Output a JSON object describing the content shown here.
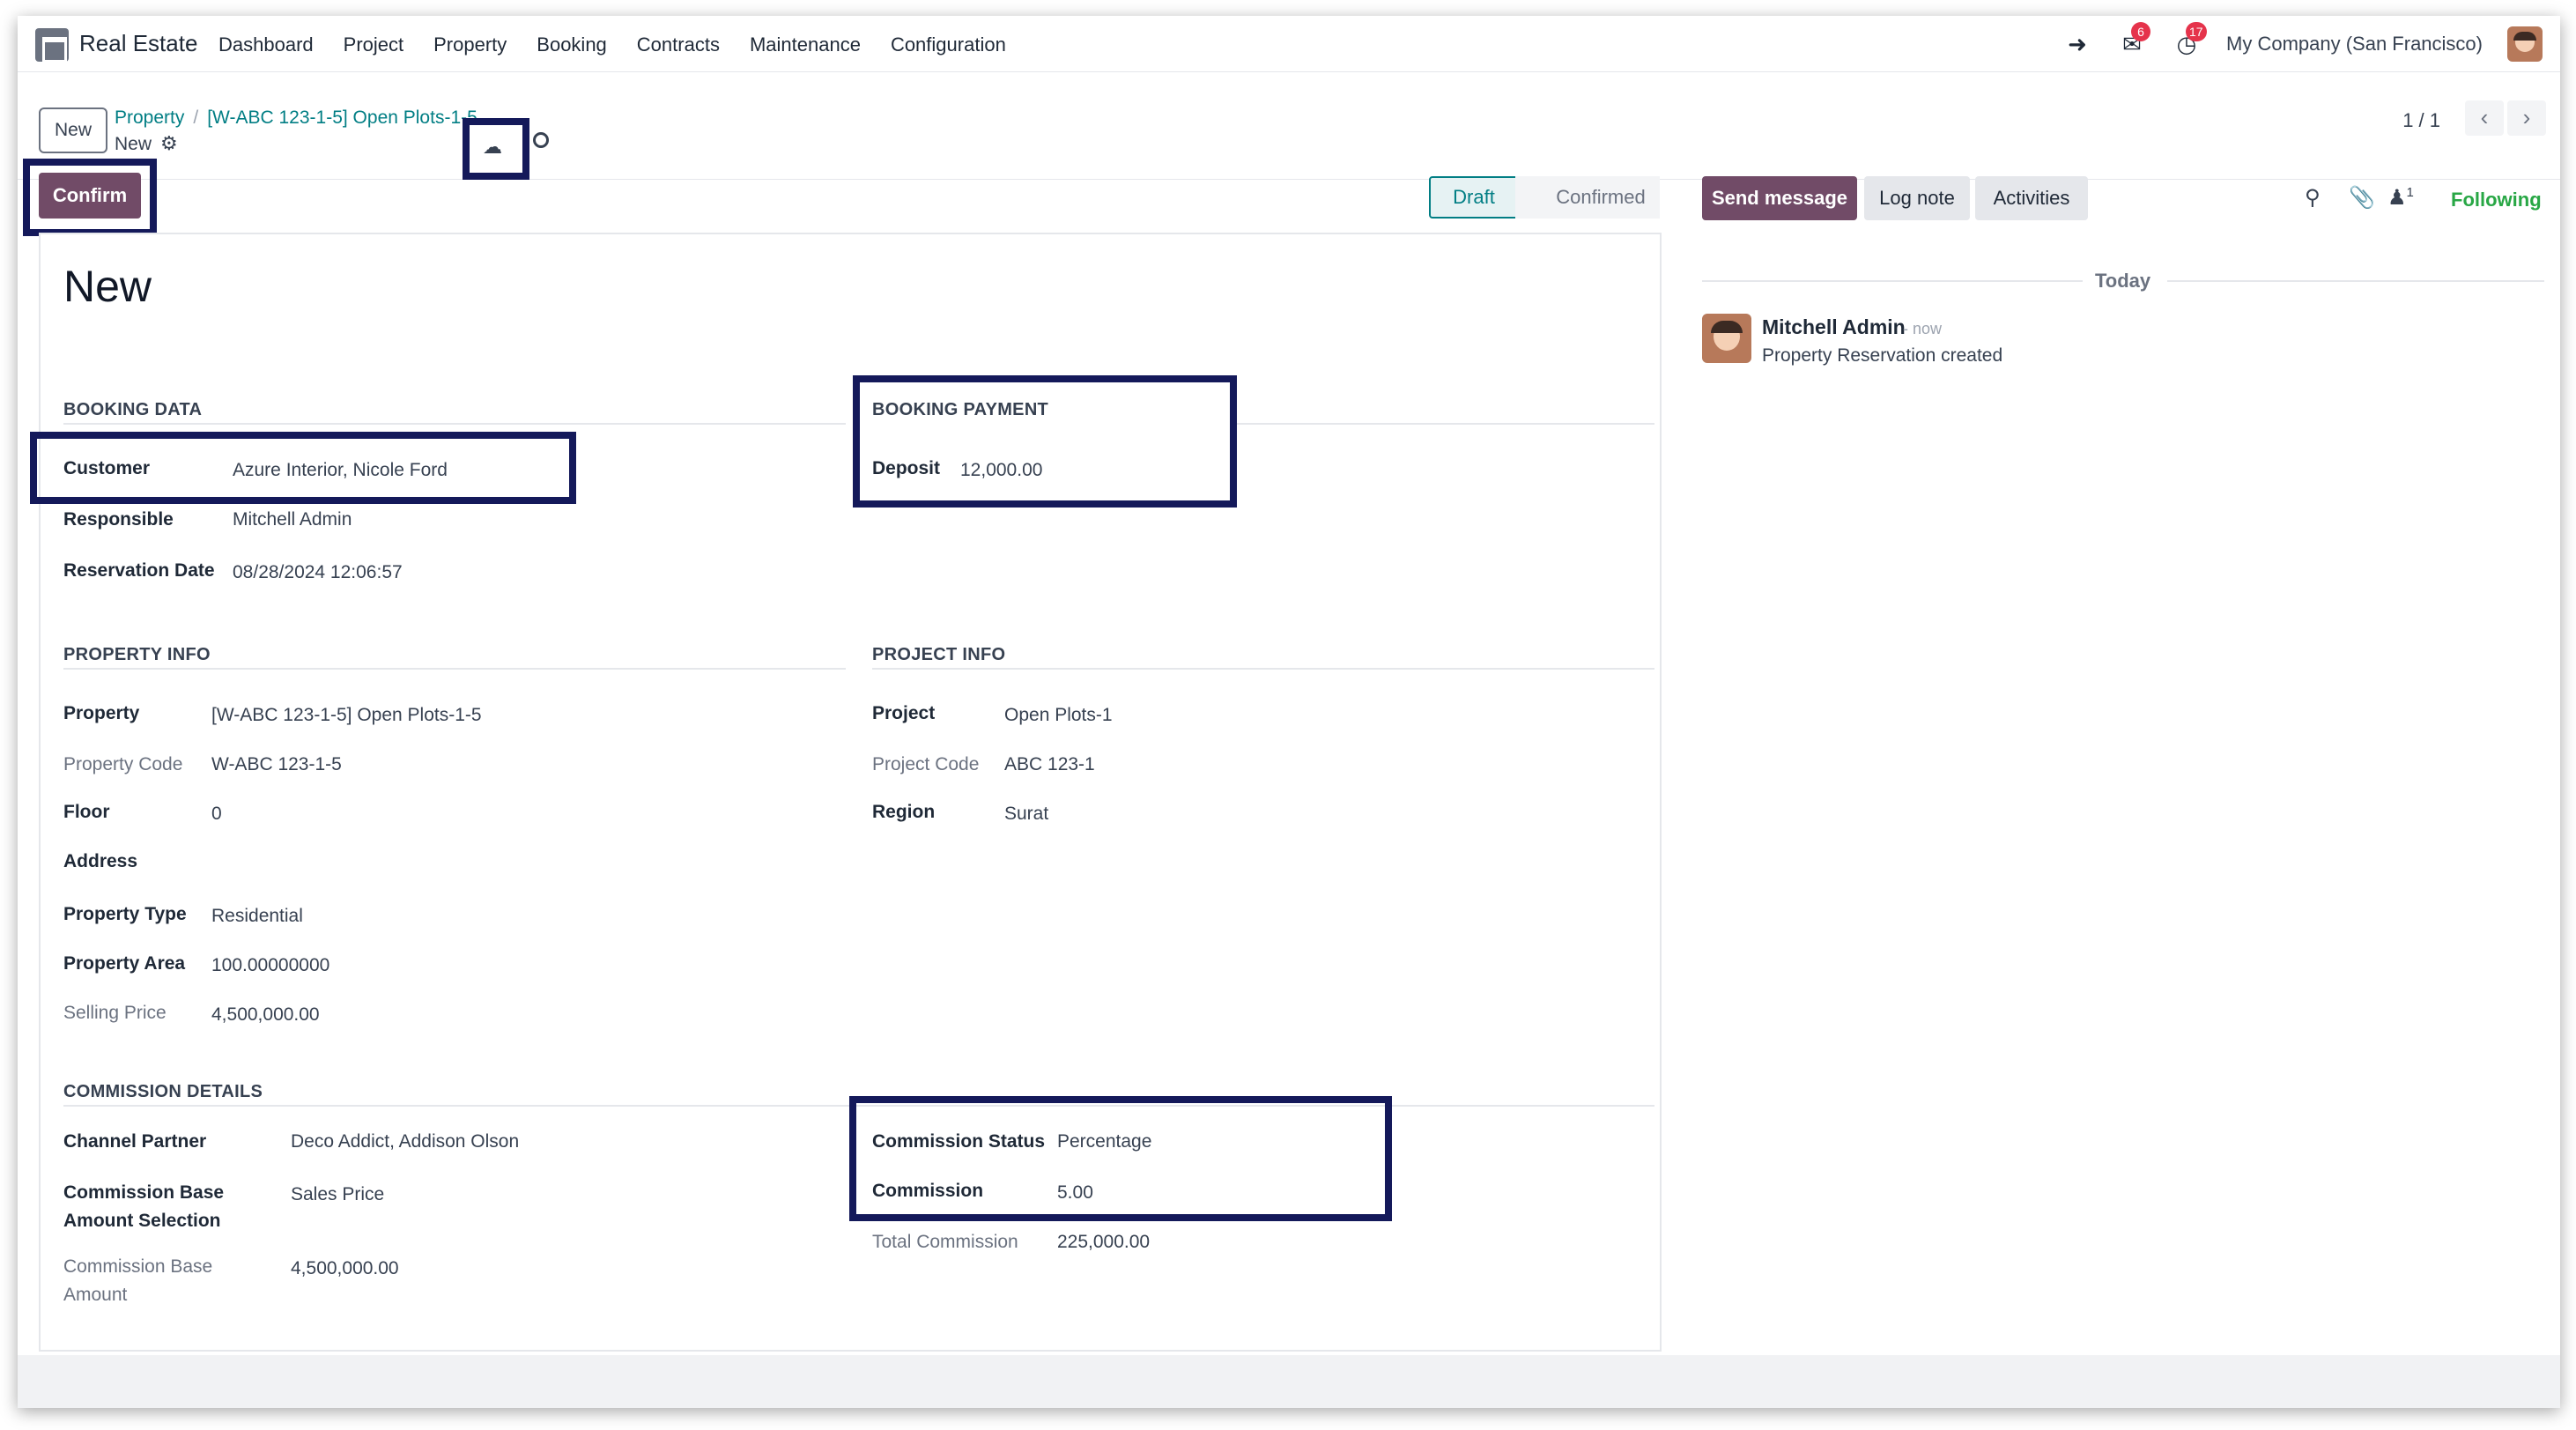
{
  "navbar": {
    "app_name": "Real Estate",
    "menu": [
      "Dashboard",
      "Project",
      "Property",
      "Booking",
      "Contracts",
      "Maintenance",
      "Configuration"
    ],
    "messages_badge": "6",
    "activities_badge": "17",
    "company": "My Company (San Francisco)"
  },
  "control": {
    "new_label": "New",
    "breadcrumb_parent": "Property",
    "breadcrumb_record": "[W-ABC 123-1-5] Open Plots-1-5",
    "record_title": "New",
    "pager": "1 / 1"
  },
  "header": {
    "confirm_label": "Confirm",
    "statuses": [
      "Draft",
      "Confirmed"
    ],
    "active_status": "Draft"
  },
  "form": {
    "name": "New",
    "booking_data": {
      "title": "BOOKING DATA",
      "customer_label": "Customer",
      "customer": "Azure Interior, Nicole Ford",
      "responsible_label": "Responsible",
      "responsible": "Mitchell Admin",
      "reservation_date_label": "Reservation Date",
      "reservation_date": "08/28/2024 12:06:57"
    },
    "booking_payment": {
      "title": "BOOKING PAYMENT",
      "deposit_label": "Deposit",
      "deposit": "12,000.00"
    },
    "property_info": {
      "title": "PROPERTY INFO",
      "property_label": "Property",
      "property": "[W-ABC 123-1-5] Open Plots-1-5",
      "property_code_label": "Property Code",
      "property_code": "W-ABC 123-1-5",
      "floor_label": "Floor",
      "floor": "0",
      "address_label": "Address",
      "property_type_label": "Property Type",
      "property_type": "Residential",
      "property_area_label": "Property Area",
      "property_area": "100.00000000",
      "selling_price_label": "Selling Price",
      "selling_price": "4,500,000.00"
    },
    "project_info": {
      "title": "PROJECT INFO",
      "project_label": "Project",
      "project": "Open Plots-1",
      "project_code_label": "Project Code",
      "project_code": "ABC 123-1",
      "region_label": "Region",
      "region": "Surat"
    },
    "commission": {
      "title": "COMMISSION DETAILS",
      "channel_partner_label": "Channel Partner",
      "channel_partner": "Deco Addict, Addison Olson",
      "base_selection_label_1": "Commission Base",
      "base_selection_label_2": "Amount Selection",
      "base_selection": "Sales Price",
      "base_amount_label_1": "Commission Base",
      "base_amount_label_2": "Amount",
      "base_amount": "4,500,000.00",
      "status_label": "Commission Status",
      "status": "Percentage",
      "commission_label": "Commission",
      "commission": "5.00",
      "total_label": "Total Commission",
      "total": "225,000.00"
    }
  },
  "chatter": {
    "send_message": "Send message",
    "log_note": "Log note",
    "activities": "Activities",
    "followers_count": "1",
    "following": "Following",
    "date_separator": "Today",
    "message": {
      "author": "Mitchell Admin",
      "time": "- now",
      "body": "Property Reservation created"
    }
  },
  "colors": {
    "primary": "#714b67",
    "accent": "#017e84",
    "highlight_border": "#14195a",
    "following": "#28a745"
  }
}
